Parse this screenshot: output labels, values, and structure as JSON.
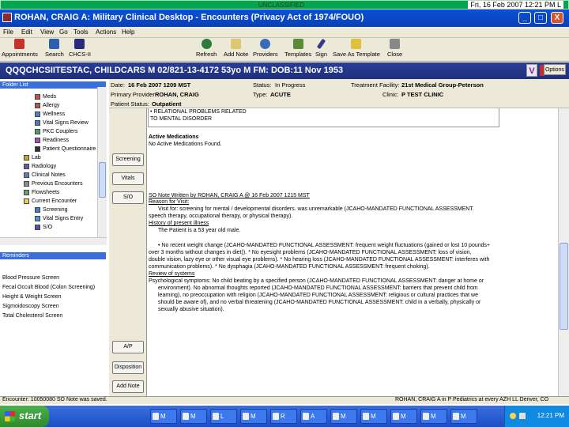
{
  "classification": "UNCLASSIFIED",
  "datetime": "Fri, 16 Feb 2007 12:21 PM L",
  "title": "ROHAN, CRAIG A: Military Clinical Desktop - Encounters (Privacy Act of 1974/FOUO)",
  "window_controls": {
    "minimize": "_",
    "maximize": "□",
    "close": "X"
  },
  "menu": [
    "File",
    "Edit",
    "View",
    "Go",
    "Tools",
    "Actions",
    "Help"
  ],
  "toolbar": {
    "left": [
      {
        "label": "Appointments",
        "icon": "calendar-icon",
        "color": "#c8322d"
      },
      {
        "label": "Search",
        "icon": "search-icon",
        "color": "#2d5fb0"
      },
      {
        "label": "CHCS-II",
        "icon": "chcs-icon",
        "color": "#2a2a7a"
      }
    ],
    "right": [
      {
        "label": "Refresh",
        "icon": "refresh-icon",
        "color": "#2d7a3a"
      },
      {
        "label": "Add Note",
        "icon": "note-icon",
        "color": "#dcc870"
      },
      {
        "label": "Providers",
        "icon": "providers-icon",
        "color": "#3a6ab8"
      },
      {
        "label": "Templates",
        "icon": "templates-icon",
        "color": "#5a8a3a"
      },
      {
        "label": "Sign",
        "icon": "sign-icon",
        "color": "#3a3a8a"
      },
      {
        "label": "Save As Template",
        "icon": "save-template-icon",
        "color": "#e0c040"
      },
      {
        "label": "Close",
        "icon": "close-doc-icon",
        "color": "#888888"
      }
    ]
  },
  "patient": {
    "banner": "QQQCHCSIITESTAC, CHILDCARS M  02/821-13-4172  53yo  M  FM:  DOB:11 Nov 1953",
    "v_label": "V",
    "options_label": "Options"
  },
  "folder_list": {
    "title": "Folder List",
    "items": [
      "Meds",
      "Allergy",
      "Wellness",
      "Vital Signs Review",
      "PKC Couplers",
      "Readiness",
      "Patient Questionnaire",
      "Lab",
      "Radiology",
      "Clinical Notes",
      "Previous Encounters",
      "Flowsheets",
      "Current Encounter",
      "Screening",
      "Vital Signs Entry",
      "S/O"
    ]
  },
  "reminders": {
    "title": "Reminders",
    "items": [
      "Blood Pressure Screen",
      "Fecal Occult Blood (Colon Screening)",
      "Height & Weight Screen",
      "Sigmoidoscopy Screen",
      "Total Cholesterol Screen"
    ]
  },
  "header": {
    "date_label": "Date:",
    "date": "16 Feb 2007 1209 MST",
    "status_label": "Status:",
    "status": "In Progress",
    "facility_label": "Treatment Facility:",
    "facility": "21st Medical Group-Peterson",
    "provider_label": "Primary Provider:",
    "provider": "ROHAN, CRAIG",
    "type_label": "Type:",
    "type": "ACUTE",
    "clinic_label": "Clinic:",
    "clinic": "P TEST CLINIC",
    "patient_status_label": "Patient Status:",
    "patient_status": "Outpatient"
  },
  "nav_buttons": {
    "screening": "Screening",
    "vitals": "Vitals",
    "so": "S/O",
    "ap": "A/P",
    "disposition": "Disposition",
    "add_note": "Add Note"
  },
  "document": {
    "lines": [
      "• RELATIONAL PROBLEMS RELATED",
      "   TO MENTAL DISORDER",
      "Active Medications",
      "No Active Medications Found.",
      "SO Note Written by ROHAN, CRAIG A @ 16 Feb 2007 1215 MST",
      "Reason for Visit:",
      "Visit for: screening for mental / developmental disorders. was unremarkable (JCAHO-MANDATED FUNCTIONAL ASSESSMENT.",
      "speech therapy, occupational therapy, or physical therapy).",
      "History of present illness",
      "The Patient is a 53 year old male.",
      "• No recent weight change (JCAHO-MANDATED FUNCTIONAL ASSESSMENT: frequent weight fluctuations (gained or lost 10 pounds+",
      "over 3 months without changes in diet)). * No eyesight problems (JCAHO-MANDATED FUNCTIONAL ASSESSMENT: loss of vision,",
      "double vision, lazy eye or other visual eye problems). * No hearing loss (JCAHO-MANDATED FUNCTIONAL ASSESSMENT: interferes with",
      "communication problems). * No dysphagia (JCAHO-MANDATED FUNCTIONAL ASSESSMENT: frequent choking).",
      "Review of systems",
      "Psychological symptoms: No child beating by a specified person (JCAHO-MANDATED FUNCTIONAL ASSESSMENT: danger at home or",
      "environment). No abnormal thoughts reported (JCAHO-MANDATED FUNCTIONAL ASSESSMENT: barriers that prevent child from",
      "learning), no preoccupation with religion (JCAHO-MANDATED FUNCTIONAL ASSESSMENT: religious or cultural practices that we",
      "should be aware of), and no verbal threatening (JCAHO-MANDATED FUNCTIONAL ASSESSMENT: child in a verbally, physically or",
      "sexually abusive situation)."
    ]
  },
  "statusbar": {
    "left": "Encounter: 10050080 SO Note was saved.",
    "right": "ROHAN, CRAIG A in P Pediatrics at every AZH LL Denver, CO"
  },
  "taskbar": {
    "start": "start",
    "buttons": [
      "M",
      "M",
      "L",
      "M",
      "R",
      "A",
      "M",
      "M",
      "M",
      "M",
      "M"
    ],
    "clock": "12:21 PM"
  }
}
